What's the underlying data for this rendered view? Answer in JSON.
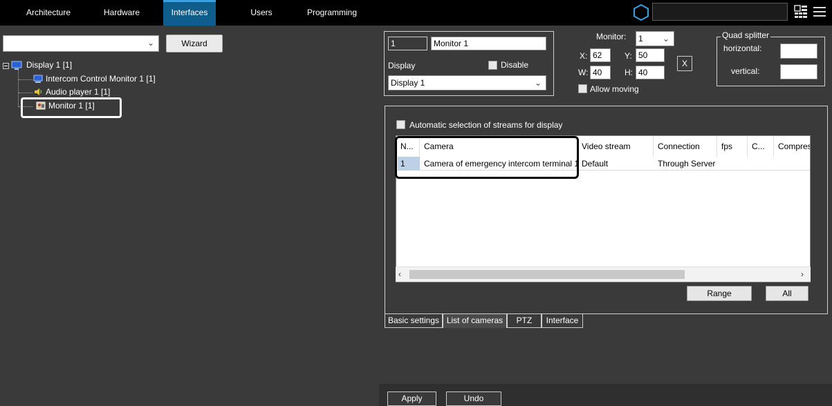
{
  "topbar": {
    "items": [
      {
        "label": "Architecture"
      },
      {
        "label": "Hardware"
      },
      {
        "label": "Interfaces"
      },
      {
        "label": "Users"
      },
      {
        "label": "Programming"
      }
    ],
    "active_index": 2,
    "search_value": ""
  },
  "left": {
    "select_value": "",
    "wizard_label": "Wizard",
    "tree": {
      "root": "Display 1 [1]",
      "children": [
        "Intercom Control Monitor 1 [1]",
        "Audio player 1 [1]",
        "Monitor 1 [1]"
      ]
    }
  },
  "right": {
    "id_value": "1",
    "name_value": "Monitor 1",
    "display_label": "Display",
    "disable_label": "Disable",
    "display_select_value": "Display 1",
    "monitor_label": "Monitor:",
    "monitor_value": "1",
    "x_label": "X:",
    "x_value": "62",
    "y_label": "Y:",
    "y_value": "50",
    "w_label": "W:",
    "w_value": "40",
    "h_label": "H:",
    "h_value": "40",
    "close_glyph": "X",
    "allow_moving_label": "Allow moving",
    "quad": {
      "title": "Quad splitter",
      "horizontal_label": "horizontal:",
      "vertical_label": "vertical:"
    },
    "auto_select_label": "Automatic selection of streams for display",
    "grid": {
      "columns": [
        "N...",
        "Camera",
        "Video stream",
        "Connection",
        "fps",
        "C...",
        "Compres"
      ],
      "rows": [
        [
          "1",
          "Camera of emergency intercom terminal 1",
          "Default",
          "Through Server",
          "",
          "",
          ""
        ]
      ]
    },
    "range_label": "Range",
    "all_label": "All",
    "tabs": [
      "Basic settings",
      "List of cameras",
      "PTZ",
      "Interface"
    ],
    "active_tab": 1,
    "apply_label": "Apply",
    "undo_label": "Undo"
  },
  "colors": {
    "accent": "#0f5d8a",
    "background": "#3a3a3a",
    "topbar": "#000000"
  },
  "icons": [
    "hexagon-icon",
    "grid-view-icon",
    "hamburger-menu-icon",
    "display-icon",
    "monitor-icon",
    "audio-icon",
    "camera-monitor-icon",
    "chevron-down-icon",
    "scroll-left-icon",
    "scroll-right-icon"
  ]
}
